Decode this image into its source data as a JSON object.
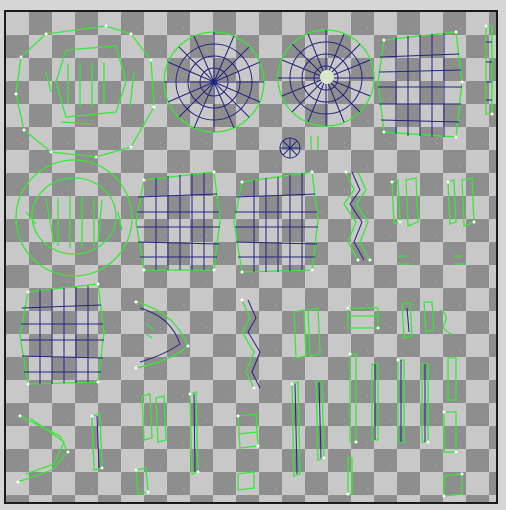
{
  "editor": {
    "panel": "uv-texture-editor",
    "checker_colors": {
      "light": "#c8c8c8",
      "dark": "#8e8e8e"
    },
    "edge_colors": {
      "uv_border": "#39e639",
      "uv_edge": "#23247e",
      "vertex": "#ffffff"
    }
  }
}
